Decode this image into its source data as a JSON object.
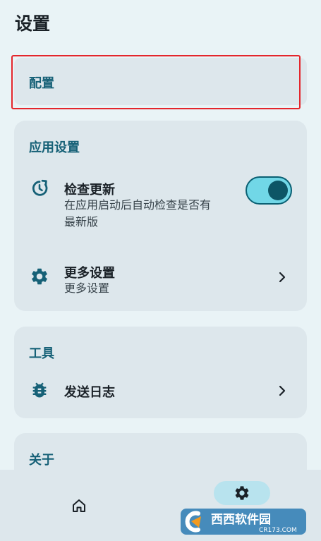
{
  "page": {
    "title": "设置"
  },
  "config_card": {
    "label": "配置"
  },
  "app_settings": {
    "section_title": "应用设置",
    "check_update": {
      "title": "检查更新",
      "subtitle_line1": "在应用启动后自动检查是否有",
      "subtitle_line2": "最新版",
      "toggle_on": true
    },
    "more_settings": {
      "title": "更多设置",
      "subtitle": "更多设置"
    }
  },
  "tools": {
    "section_title": "工具",
    "send_log": {
      "title": "发送日志"
    }
  },
  "about": {
    "section_title": "关于"
  },
  "bottom_nav": {
    "items": [
      {
        "icon": "home-icon",
        "selected": false
      },
      {
        "icon": "gear-icon",
        "selected": true
      }
    ]
  },
  "watermark": {
    "brand": "西西软件园",
    "site": "CR173.COM"
  },
  "colors": {
    "background": "#e9f3f6",
    "card": "#dde7ec",
    "accent": "#166177",
    "toggle_track": "#71d7e7",
    "toggle_knob": "#0d5566",
    "highlight": "#e4262c"
  }
}
